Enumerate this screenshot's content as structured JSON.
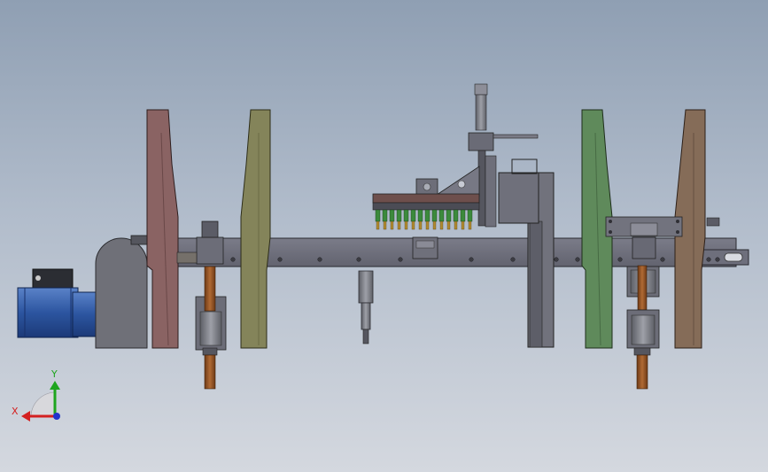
{
  "triad": {
    "x_label": "X",
    "y_label": "Y",
    "x_color": "#d42020",
    "y_color": "#1ea51e",
    "z_color": "#2233cc"
  },
  "colors": {
    "background_top": "#8f9fb3",
    "background_bottom": "#d4d8df",
    "beam": "#6e6f7c",
    "left_plate_red": "#8a6363",
    "left_plate_olive": "#84845a",
    "right_plate_green": "#5f8a5b",
    "right_plate_brown": "#856c58",
    "motor_blue": "#2c55a0",
    "shaft_copper": "#9a5a2a",
    "nozzle_green": "#3c8a3c"
  },
  "components": [
    "drive-motor",
    "gear-housing",
    "main-beam",
    "left-frame-plates",
    "right-frame-plates",
    "center-nozzle-head",
    "vertical-cylinder",
    "lift-shafts"
  ]
}
